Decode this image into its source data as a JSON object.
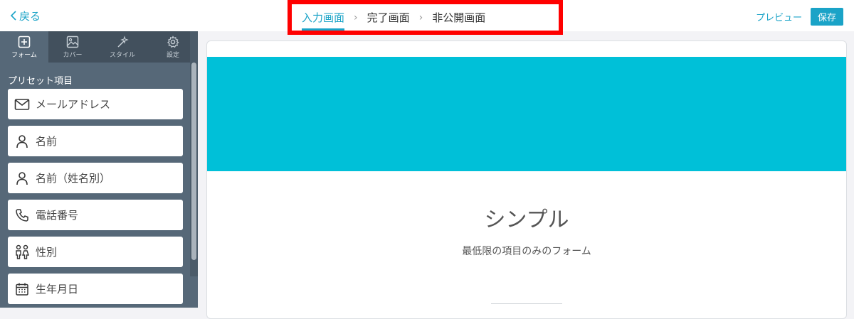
{
  "header": {
    "back_label": "戻る",
    "steps": [
      {
        "label": "入力画面",
        "active": true
      },
      {
        "label": "完了画面",
        "active": false
      },
      {
        "label": "非公開画面",
        "active": false
      }
    ],
    "step_separator": "›",
    "preview_label": "プレビュー",
    "save_label": "保存"
  },
  "sidebar": {
    "tabs": [
      {
        "label": "フォーム",
        "icon": "plus-square-icon",
        "active": true
      },
      {
        "label": "カバー",
        "icon": "image-icon",
        "active": false
      },
      {
        "label": "スタイル",
        "icon": "wand-icon",
        "active": false
      },
      {
        "label": "設定",
        "icon": "gear-icon",
        "active": false
      }
    ],
    "section_title": "プリセット項目",
    "items": [
      {
        "label": "メールアドレス",
        "icon": "mail-icon"
      },
      {
        "label": "名前",
        "icon": "person-icon"
      },
      {
        "label": "名前（姓名別）",
        "icon": "person-icon"
      },
      {
        "label": "電話番号",
        "icon": "phone-icon"
      },
      {
        "label": "性別",
        "icon": "gender-icon"
      },
      {
        "label": "生年月日",
        "icon": "calendar-icon"
      }
    ]
  },
  "form": {
    "title": "シンプル",
    "description": "最低限の項目のみのフォーム"
  },
  "colors": {
    "accent": "#1aa3c7",
    "cover": "#00c0d8",
    "sidebar": "#566878",
    "highlight_box": "#ff0000"
  }
}
